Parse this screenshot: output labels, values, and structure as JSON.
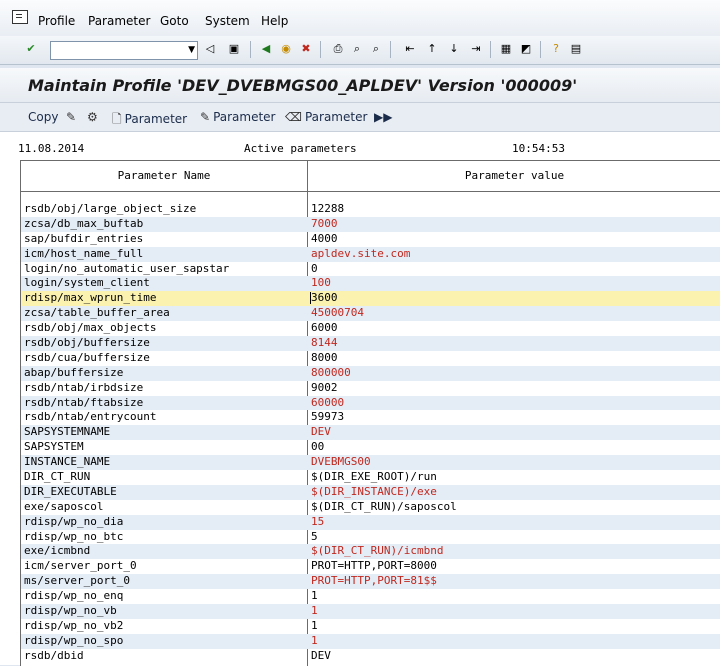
{
  "menu": [
    "Profile",
    "Parameter",
    "Goto",
    "System",
    "Help"
  ],
  "toolbar": {
    "command_value": "",
    "icons": [
      "enter-icon",
      "save-icon",
      "back-icon",
      "exit-icon",
      "cancel-icon",
      "print-icon",
      "find-icon",
      "find-next-icon",
      "first-page-icon",
      "prev-page-icon",
      "next-page-icon",
      "last-page-icon",
      "new-session-icon",
      "shortcut-icon",
      "help-icon",
      "layout-icon"
    ]
  },
  "title": "Maintain Profile 'DEV_DVEBMGS00_APLDEV' Version '000009'",
  "app_toolbar": {
    "copy": "Copy",
    "param1": "Parameter",
    "param2": "Parameter",
    "param3": "Parameter"
  },
  "info": {
    "date": "11.08.2014",
    "status": "Active parameters",
    "time": "10:54:53"
  },
  "grid": {
    "col_name": "Parameter Name",
    "col_value": "Parameter value",
    "rows": [
      {
        "name": "rsdb/obj/large_object_size",
        "value": "12288",
        "red": false
      },
      {
        "name": "zcsa/db_max_buftab",
        "value": "7000",
        "red": true
      },
      {
        "name": "sap/bufdir_entries",
        "value": "4000",
        "red": false
      },
      {
        "name": "icm/host_name_full",
        "value": "apldev.site.com",
        "red": true
      },
      {
        "name": "login/no_automatic_user_sapstar",
        "value": "0",
        "red": false
      },
      {
        "name": "login/system_client",
        "value": "100",
        "red": true
      },
      {
        "name": "rdisp/max_wprun_time",
        "value": "3600",
        "red": false
      },
      {
        "name": "zcsa/table_buffer_area",
        "value": "45000704",
        "red": true
      },
      {
        "name": "rsdb/obj/max_objects",
        "value": "6000",
        "red": false
      },
      {
        "name": "rsdb/obj/buffersize",
        "value": "8144",
        "red": true
      },
      {
        "name": "rsdb/cua/buffersize",
        "value": "8000",
        "red": false
      },
      {
        "name": "abap/buffersize",
        "value": "800000",
        "red": true
      },
      {
        "name": "rsdb/ntab/irbdsize",
        "value": "9002",
        "red": false
      },
      {
        "name": "rsdb/ntab/ftabsize",
        "value": "60000",
        "red": true
      },
      {
        "name": "rsdb/ntab/entrycount",
        "value": "59973",
        "red": false
      },
      {
        "name": "SAPSYSTEMNAME",
        "value": "DEV",
        "red": true
      },
      {
        "name": "SAPSYSTEM",
        "value": "00",
        "red": false
      },
      {
        "name": "INSTANCE_NAME",
        "value": "DVEBMGS00",
        "red": true
      },
      {
        "name": "DIR_CT_RUN",
        "value": "$(DIR_EXE_ROOT)/run",
        "red": false
      },
      {
        "name": "DIR_EXECUTABLE",
        "value": "$(DIR_INSTANCE)/exe",
        "red": true
      },
      {
        "name": "exe/saposcol",
        "value": "$(DIR_CT_RUN)/saposcol",
        "red": false
      },
      {
        "name": "rdisp/wp_no_dia",
        "value": "15",
        "red": true
      },
      {
        "name": "rdisp/wp_no_btc",
        "value": "5",
        "red": false
      },
      {
        "name": "exe/icmbnd",
        "value": "$(DIR_CT_RUN)/icmbnd",
        "red": true
      },
      {
        "name": "icm/server_port_0",
        "value": "PROT=HTTP,PORT=8000",
        "red": false
      },
      {
        "name": "ms/server_port_0",
        "value": "PROT=HTTP,PORT=81$$",
        "red": true
      },
      {
        "name": "rdisp/wp_no_enq",
        "value": "1",
        "red": false
      },
      {
        "name": "rdisp/wp_no_vb",
        "value": "1",
        "red": true
      },
      {
        "name": "rdisp/wp_no_vb2",
        "value": "1",
        "red": false
      },
      {
        "name": "rdisp/wp_no_spo",
        "value": "1",
        "red": true
      },
      {
        "name": "rsdb/dbid",
        "value": "DEV",
        "red": false
      }
    ]
  }
}
